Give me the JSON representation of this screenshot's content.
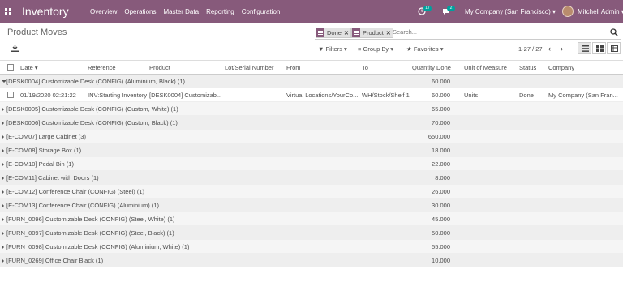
{
  "topbar": {
    "app_title": "Inventory",
    "menu": [
      "Overview",
      "Operations",
      "Master Data",
      "Reporting",
      "Configuration"
    ],
    "activity_count": "17",
    "message_count": "2",
    "company": "My Company (San Francisco)",
    "user": "Mitchell Admin",
    "color": "#875a7b"
  },
  "control_panel": {
    "page_title": "Product Moves",
    "facets": [
      "Done",
      "Product"
    ],
    "search_placeholder": "Search...",
    "filters": "Filters",
    "group_by": "Group By",
    "favorites": "Favorites",
    "pager": "1-27 / 27"
  },
  "table": {
    "columns": [
      "Date",
      "Reference",
      "Product",
      "Lot/Serial Number",
      "From",
      "To",
      "Quantity Done",
      "Unit of Measure",
      "Status",
      "Company"
    ],
    "groups": [
      {
        "label": "[DESK0004] Customizable Desk (CONFIG) (Aluminium, Black) (1)",
        "qty": "60.000",
        "expanded": true,
        "rows": [
          {
            "date": "01/19/2020 02:21:22",
            "reference": "INV:Starting Inventory",
            "product": "[DESK0004] Customizab...",
            "lot": "",
            "from": "Virtual Locations/YourCo...",
            "to": "WH/Stock/Shelf 1",
            "qty": "60.000",
            "uom": "Units",
            "status": "Done",
            "company": "My Company (San Fran..."
          }
        ]
      },
      {
        "label": "[DESK0005] Customizable Desk (CONFIG) (Custom, White) (1)",
        "qty": "65.000"
      },
      {
        "label": "[DESK0006] Customizable Desk (CONFIG) (Custom, Black) (1)",
        "qty": "70.000"
      },
      {
        "label": "[E-COM07] Large Cabinet (3)",
        "qty": "650.000"
      },
      {
        "label": "[E-COM08] Storage Box (1)",
        "qty": "18.000"
      },
      {
        "label": "[E-COM10] Pedal Bin (1)",
        "qty": "22.000"
      },
      {
        "label": "[E-COM11] Cabinet with Doors (1)",
        "qty": "8.000"
      },
      {
        "label": "[E-COM12] Conference Chair (CONFIG) (Steel) (1)",
        "qty": "26.000"
      },
      {
        "label": "[E-COM13] Conference Chair (CONFIG) (Aluminium) (1)",
        "qty": "30.000"
      },
      {
        "label": "[FURN_0096] Customizable Desk (CONFIG) (Steel, White) (1)",
        "qty": "45.000"
      },
      {
        "label": "[FURN_0097] Customizable Desk (CONFIG) (Steel, Black) (1)",
        "qty": "50.000"
      },
      {
        "label": "[FURN_0098] Customizable Desk (CONFIG) (Aluminium, White) (1)",
        "qty": "55.000"
      },
      {
        "label": "[FURN_0269] Office Chair Black (1)",
        "qty": "10.000"
      }
    ]
  }
}
